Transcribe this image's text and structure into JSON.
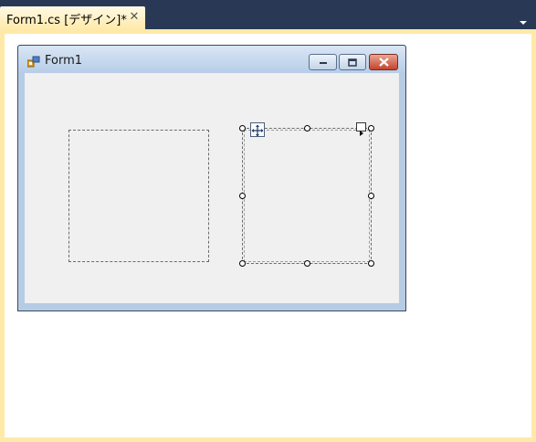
{
  "document_tab": {
    "title": "Form1.cs [デザイン]*",
    "close_glyph": "✕"
  },
  "form": {
    "title": "Form1",
    "icon": "form-icon",
    "caption_buttons": [
      "minimize",
      "maximize",
      "close"
    ]
  },
  "designer": {
    "controls": [
      {
        "name": "panel1",
        "selected": false
      },
      {
        "name": "panel2",
        "selected": true
      }
    ]
  },
  "colors": {
    "ide_background": "#293955",
    "tab_active": "#ffe9a8",
    "form_client": "#f0f0f0",
    "close_button": "#c4442c"
  }
}
